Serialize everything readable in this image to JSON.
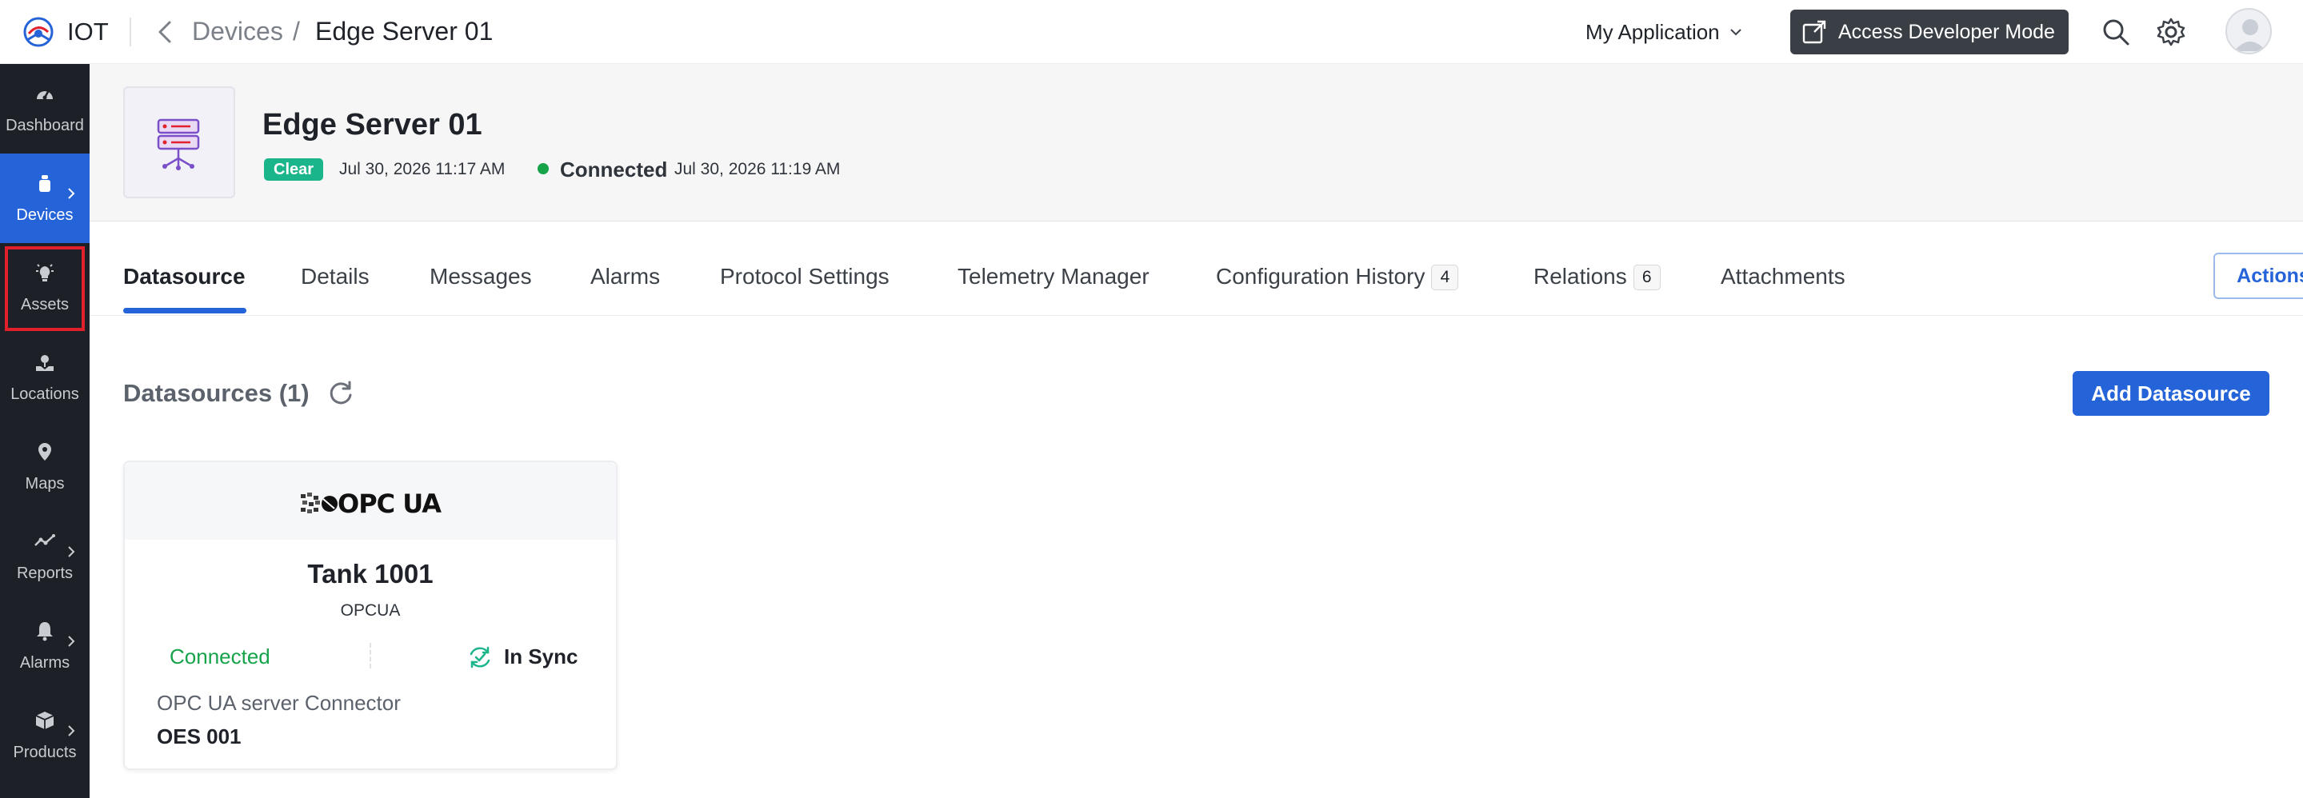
{
  "topbar": {
    "app_name": "IOT",
    "breadcrumb_parent": "Devices",
    "breadcrumb_separator": "/",
    "breadcrumb_current": "Edge Server 01",
    "app_selector": "My Application",
    "dev_mode_label": "Access Developer Mode"
  },
  "sidebar": {
    "items": [
      {
        "label": "Dashboard",
        "icon": "dashboard-icon",
        "active": false,
        "has_submenu": false
      },
      {
        "label": "Devices",
        "icon": "devices-icon",
        "active": true,
        "has_submenu": true
      },
      {
        "label": "Assets",
        "icon": "assets-icon",
        "active": false,
        "has_submenu": false
      },
      {
        "label": "Locations",
        "icon": "locations-icon",
        "active": false,
        "has_submenu": false
      },
      {
        "label": "Maps",
        "icon": "maps-icon",
        "active": false,
        "has_submenu": false
      },
      {
        "label": "Reports",
        "icon": "reports-icon",
        "active": false,
        "has_submenu": true
      },
      {
        "label": "Alarms",
        "icon": "alarms-icon",
        "active": false,
        "has_submenu": true
      },
      {
        "label": "Products",
        "icon": "products-icon",
        "active": false,
        "has_submenu": true
      }
    ]
  },
  "device": {
    "name": "Edge Server 01",
    "status_badge": "Clear",
    "status_time": "Jul 30, 2026 11:17 AM",
    "connection": "Connected",
    "connection_time": "Jul 30, 2026 11:19 AM"
  },
  "tabs": [
    {
      "label": "Datasource",
      "active": true,
      "count": null
    },
    {
      "label": "Details",
      "active": false,
      "count": null
    },
    {
      "label": "Messages",
      "active": false,
      "count": null
    },
    {
      "label": "Alarms",
      "active": false,
      "count": null
    },
    {
      "label": "Protocol Settings",
      "active": false,
      "count": null
    },
    {
      "label": "Telemetry Manager",
      "active": false,
      "count": null
    },
    {
      "label": "Configuration History",
      "active": false,
      "count": "4"
    },
    {
      "label": "Relations",
      "active": false,
      "count": "6"
    },
    {
      "label": "Attachments",
      "active": false,
      "count": null
    }
  ],
  "actions_label": "Actions",
  "datasources": {
    "title": "Datasources (1)",
    "add_label": "Add Datasource",
    "cards": [
      {
        "logo_text": "OPC UA",
        "name": "Tank 1001",
        "protocol": "OPCUA",
        "status": "Connected",
        "sync": "In Sync",
        "connector": "OPC UA server Connector",
        "code": "OES 001"
      }
    ]
  },
  "colors": {
    "accent": "#2563d8",
    "sidebar_bg": "#1d2127",
    "success": "#16a34a",
    "badge_clear": "#1bb58b",
    "highlight": "#e2202b"
  }
}
